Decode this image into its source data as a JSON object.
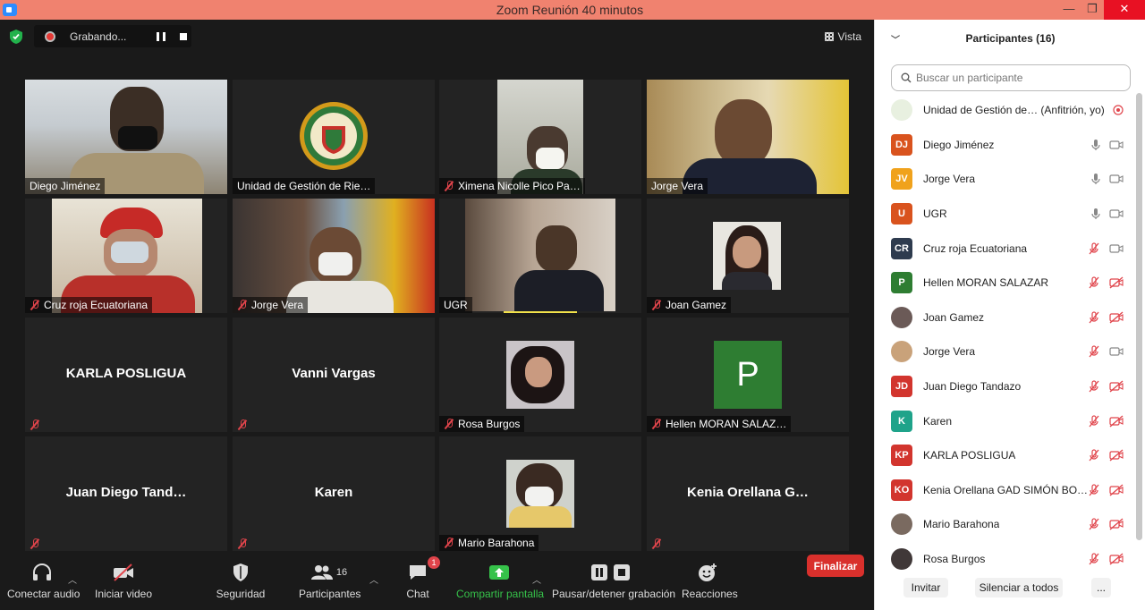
{
  "window": {
    "title": "Zoom Reunión 40 minutos",
    "minimize": "—",
    "maximize": "❐",
    "close": "✕"
  },
  "topbar": {
    "recording_label": "Grabando...",
    "view_label": "Vista"
  },
  "tiles": [
    {
      "name": "Diego Jiménez",
      "muted": false,
      "kind": "video"
    },
    {
      "name": "Unidad de Gestión de Rie…",
      "muted": false,
      "kind": "logo"
    },
    {
      "name": "Ximena Nicolle Pico Pa…",
      "muted": true,
      "kind": "video"
    },
    {
      "name": "Jorge Vera",
      "muted": false,
      "kind": "video"
    },
    {
      "name": "Cruz roja Ecuatoriana",
      "muted": true,
      "kind": "video"
    },
    {
      "name": "Jorge Vera",
      "muted": true,
      "kind": "video"
    },
    {
      "name": "UGR",
      "muted": false,
      "kind": "video"
    },
    {
      "name": "Joan Gamez",
      "muted": true,
      "kind": "photo"
    },
    {
      "name": "KARLA POSLIGUA",
      "muted": true,
      "kind": "text"
    },
    {
      "name": "Vanni Vargas",
      "muted": true,
      "kind": "text"
    },
    {
      "name": "Rosa Burgos",
      "muted": true,
      "kind": "photo"
    },
    {
      "name": "Hellen MORAN SALAZ…",
      "muted": true,
      "kind": "avatar",
      "avatar_letter": "P"
    },
    {
      "name": "Juan Diego Tand…",
      "muted": true,
      "kind": "text"
    },
    {
      "name": "Karen",
      "muted": true,
      "kind": "text"
    },
    {
      "name": "Mario Barahona",
      "muted": true,
      "kind": "photo"
    },
    {
      "name": "Kenia Orellana G…",
      "muted": true,
      "kind": "text"
    }
  ],
  "toolbar": {
    "audio": "Conectar audio",
    "video": "Iniciar video",
    "security": "Seguridad",
    "participants": "Participantes",
    "participants_count": "16",
    "chat": "Chat",
    "chat_badge": "1",
    "share": "Compartir pantalla",
    "record": "Pausar/detener grabación",
    "reactions": "Reacciones",
    "end": "Finalizar"
  },
  "panel": {
    "title": "Participantes (16)",
    "search_placeholder": "Buscar un participante",
    "participants": [
      {
        "initials": "",
        "name": "Unidad de Gestión de… (Anfitrión, yo)",
        "color": "#e8f0e0",
        "status": "host"
      },
      {
        "initials": "DJ",
        "name": "Diego Jiménez",
        "color": "#d9531e",
        "status": "mic-cam"
      },
      {
        "initials": "JV",
        "name": "Jorge Vera",
        "color": "#f0a21c",
        "status": "mic-cam"
      },
      {
        "initials": "U",
        "name": "UGR",
        "color": "#d9531e",
        "status": "mic-cam"
      },
      {
        "initials": "CR",
        "name": "Cruz roja Ecuatoriana",
        "color": "#2e3b4e",
        "status": "muted-cam"
      },
      {
        "initials": "P",
        "name": "Hellen MORAN SALAZAR",
        "color": "#2e7d32",
        "status": "muted-nocam"
      },
      {
        "initials": "",
        "name": "Joan Gamez",
        "color": "#6b5a57",
        "status": "muted-nocam"
      },
      {
        "initials": "",
        "name": "Jorge Vera",
        "color": "#c9a27a",
        "status": "muted-cam"
      },
      {
        "initials": "JD",
        "name": "Juan Diego Tandazo",
        "color": "#d2352e",
        "status": "muted-nocam"
      },
      {
        "initials": "K",
        "name": "Karen",
        "color": "#1fa38a",
        "status": "muted-nocam"
      },
      {
        "initials": "KP",
        "name": "KARLA POSLIGUA",
        "color": "#d2352e",
        "status": "muted-nocam"
      },
      {
        "initials": "KO",
        "name": "Kenia Orellana GAD SIMÓN BO…",
        "color": "#d2352e",
        "status": "muted-nocam"
      },
      {
        "initials": "",
        "name": "Mario Barahona",
        "color": "#7a6a60",
        "status": "muted-nocam"
      },
      {
        "initials": "",
        "name": "Rosa Burgos",
        "color": "#403838",
        "status": "muted-nocam"
      }
    ],
    "invite": "Invitar",
    "mute_all": "Silenciar a todos",
    "more": "..."
  }
}
